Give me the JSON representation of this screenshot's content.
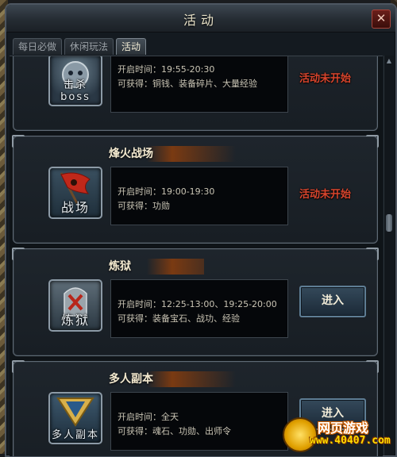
{
  "window": {
    "title": "活动",
    "close_label": "✕"
  },
  "tabs": [
    {
      "label": "每日必做",
      "active": false
    },
    {
      "label": "休闲玩法",
      "active": false
    },
    {
      "label": "活动",
      "active": true
    }
  ],
  "activities": [
    {
      "name": "",
      "icon_label": "击杀boss",
      "time_label": "开启时间：",
      "time": "19:55-20:30",
      "reward_label": "可获得：",
      "rewards": "铜钱、装备碎片、大量经验",
      "status": "活动未开始",
      "action": ""
    },
    {
      "name": "烽火战场",
      "icon_label": "战场",
      "time_label": "开启时间：",
      "time": "19:00-19:30",
      "reward_label": "可获得：",
      "rewards": "功勋",
      "status": "活动未开始",
      "action": ""
    },
    {
      "name": "炼狱",
      "icon_label": "炼狱",
      "time_label": "开启时间：",
      "time": "12:25-13:00、19:25-20:00",
      "reward_label": "可获得：",
      "rewards": "装备宝石、战功、经验",
      "status": "",
      "action": "进入"
    },
    {
      "name": "多人副本",
      "icon_label": "多人副本",
      "time_label": "开启时间：",
      "time": "全天",
      "reward_label": "可获得：",
      "rewards": "魂石、功勋、出师令",
      "status": "",
      "action": "进入"
    }
  ],
  "watermark": {
    "line1": "网页游戏",
    "line2": "www.40407.com"
  },
  "colors": {
    "status_red": "#d8452d",
    "title_text": "#f4ead0"
  }
}
